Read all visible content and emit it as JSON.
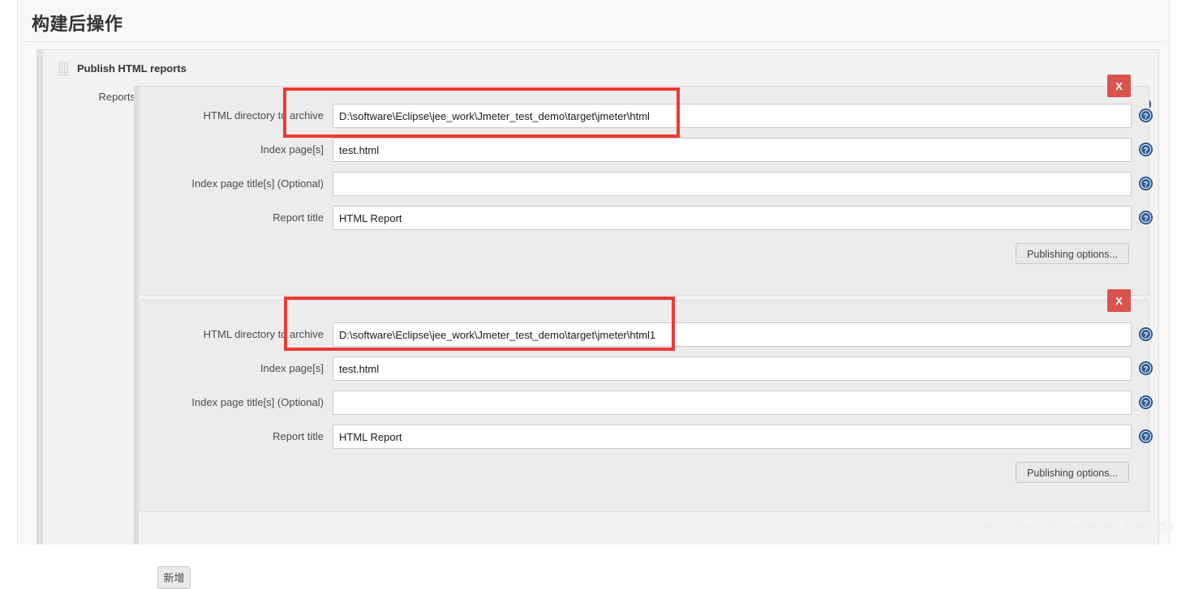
{
  "page": {
    "title": "构建后操作",
    "watermark": "https://blog.csdn.net/weixin_43664254"
  },
  "publisher": {
    "title": "Publish HTML reports",
    "drag_handle_icon": "drag-grip-icon",
    "remove_label": "X",
    "help_icon": "help-circle-icon",
    "section_label": "Reports",
    "add_label": "新增"
  },
  "labels": {
    "html_directory": "HTML directory to archive",
    "index_pages": "Index page[s]",
    "index_page_titles": "Index page title[s] (Optional)",
    "report_title": "Report title",
    "publishing_options": "Publishing options...",
    "remove": "X"
  },
  "entries": [
    {
      "html_directory": "D:\\software\\Eclipse\\jee_work\\Jmeter_test_demo\\target\\jmeter\\html",
      "index_pages": "test.html",
      "index_page_titles": "",
      "report_title": "HTML Report",
      "placeholder_directory": "",
      "placeholder_index": "",
      "placeholder_titles": "",
      "placeholder_report_title": ""
    },
    {
      "html_directory": "D:\\software\\Eclipse\\jee_work\\Jmeter_test_demo\\target\\jmeter\\html1",
      "index_pages": "test.html",
      "index_page_titles": "",
      "report_title": "HTML Report",
      "placeholder_directory": "",
      "placeholder_index": "",
      "placeholder_titles": "",
      "placeholder_report_title": ""
    }
  ],
  "colors": {
    "danger": "#d9534f",
    "annotation": "#f03a32",
    "help_blue": "#2f5d96",
    "panel": "#ececec"
  }
}
